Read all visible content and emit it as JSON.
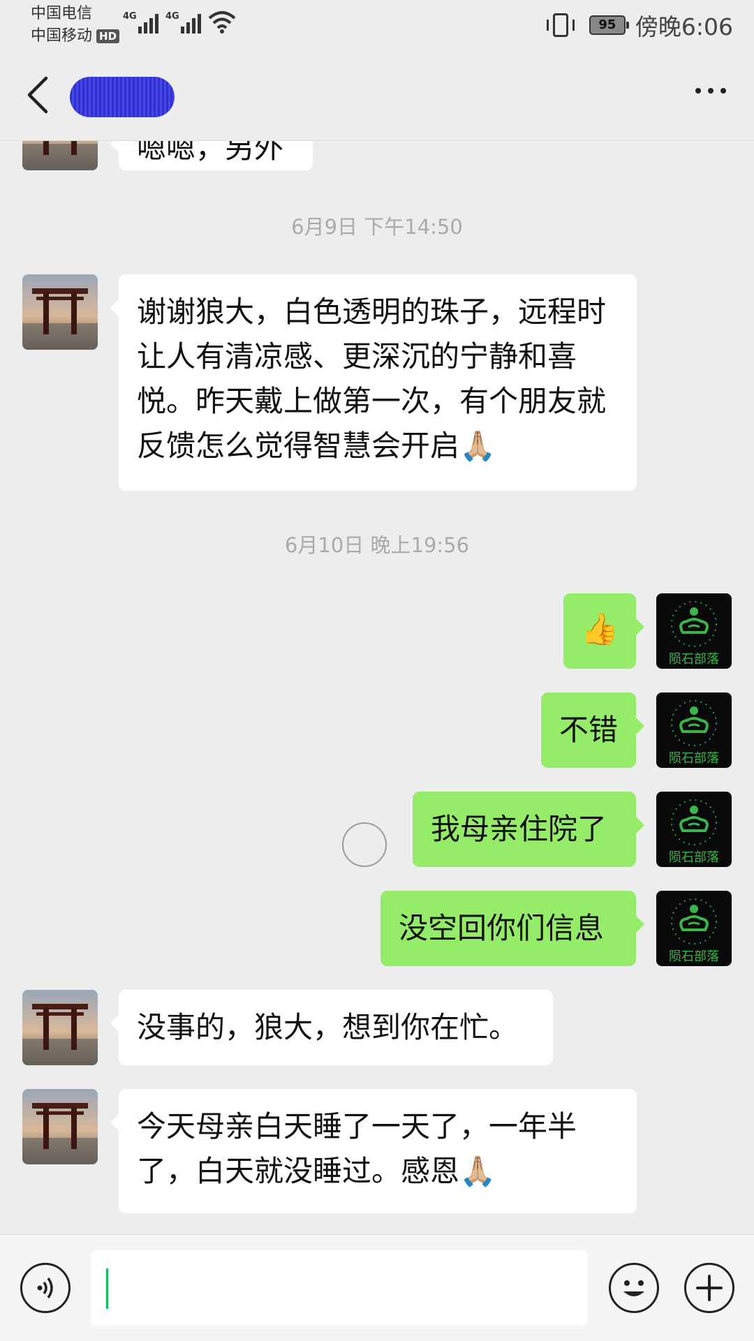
{
  "status_bar": {
    "carrier_1": "中国电信",
    "carrier_2": "中国移动",
    "hd_badge": "HD",
    "network_1": "4G",
    "network_2": "4G",
    "battery": "95",
    "time": "傍晚6:06"
  },
  "header": {
    "back_icon": "chevron-left-icon",
    "contact_name": "",
    "more_icon": "more-dots-icon"
  },
  "messages": [
    {
      "type": "text",
      "side": "left",
      "text": "嗯嗯，另外"
    },
    {
      "type": "timestamp",
      "text": "6月9日 下午14:50"
    },
    {
      "type": "text",
      "side": "left",
      "text": "谢谢狼大，白色透明的珠子，远程时让人有清凉感、更深沉的宁静和喜悦。昨天戴上做第一次，有个朋友就反馈怎么觉得智慧会开启🙏🏼"
    },
    {
      "type": "timestamp",
      "text": "6月10日 晚上19:56"
    },
    {
      "type": "text",
      "side": "right",
      "text": "👍"
    },
    {
      "type": "text",
      "side": "right",
      "text": "不错"
    },
    {
      "type": "text",
      "side": "right",
      "text": "我母亲住院了"
    },
    {
      "type": "text",
      "side": "right",
      "text": "没空回你们信息"
    },
    {
      "type": "text",
      "side": "left",
      "text": "没事的，狼大，想到你在忙。"
    },
    {
      "type": "text",
      "side": "left",
      "text": "今天母亲白天睡了一天了，一年半了，白天就没睡过。感恩🙏🏼"
    }
  ],
  "self_avatar_text": "陨石部落",
  "input_bar": {
    "voice_icon": "voice-icon",
    "emoji_icon": "smiley-icon",
    "plus_icon": "plus-icon",
    "input_value": ""
  }
}
